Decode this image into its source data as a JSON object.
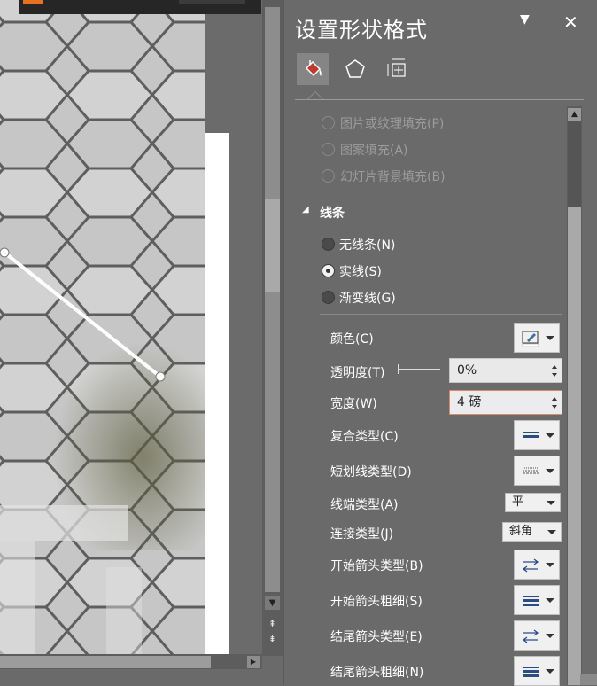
{
  "pane": {
    "title": "设置形状格式",
    "menu_glyph": "▼",
    "close_glyph": "✕",
    "tabs": [
      {
        "name": "填充与线条",
        "icon": "paint-bucket-icon",
        "selected": true
      },
      {
        "name": "效果",
        "icon": "pentagon-icon",
        "selected": false
      },
      {
        "name": "大小与属性",
        "icon": "size-properties-icon",
        "selected": false
      }
    ],
    "fill_options": [
      {
        "label": "图片或纹理填充(P)",
        "enabled": false
      },
      {
        "label": "图案填充(A)",
        "enabled": false
      },
      {
        "label": "幻灯片背景填充(B)",
        "enabled": false
      }
    ],
    "line_section": {
      "title": "线条",
      "expander": "◢",
      "options": [
        {
          "label": "无线条(N)",
          "selected": false
        },
        {
          "label": "实线(S)",
          "selected": true
        },
        {
          "label": "渐变线(G)",
          "selected": false
        }
      ],
      "color_label": "颜色(C)",
      "transparency_label": "透明度(T)",
      "transparency_value": "0%",
      "width_label": "宽度(W)",
      "width_value": "4 磅",
      "compound_label": "复合类型(C)",
      "dash_label": "短划线类型(D)",
      "cap_label": "线端类型(A)",
      "cap_value": "平",
      "join_label": "连接类型(J)",
      "join_value": "斜角",
      "begin_arrow_type_label": "开始箭头类型(B)",
      "begin_arrow_size_label": "开始箭头粗细(S)",
      "end_arrow_type_label": "结尾箭头类型(E)",
      "end_arrow_size_label": "结尾箭头粗细(N)"
    }
  },
  "colors": {
    "pane_bg": "#6a6a6a",
    "accent_fill_tab": "#c0392b",
    "line_stroke": "#ffffff"
  }
}
